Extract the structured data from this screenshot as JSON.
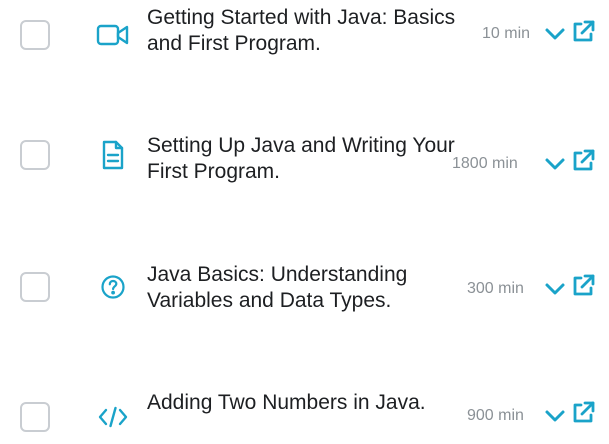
{
  "colors": {
    "accent": "#1aa3c9",
    "title_text": "#1d1f22",
    "duration_text": "#8b9196",
    "checkbox_border": "#c9cdd2"
  },
  "lessons": [
    {
      "title": "Getting Started with Java: Basics and First Program.",
      "duration": "10 min",
      "type_icon": "video-camera-icon",
      "checked": false
    },
    {
      "title": "Setting Up Java and Writing Your First Program.",
      "duration": "1800 min",
      "type_icon": "document-icon",
      "checked": false
    },
    {
      "title": "Java Basics: Understanding Variables and Data Types.",
      "duration": "300 min",
      "type_icon": "question-circle-icon",
      "checked": false
    },
    {
      "title": "Adding Two Numbers in Java.",
      "duration": "900 min",
      "type_icon": "code-brackets-icon",
      "checked": false
    }
  ]
}
